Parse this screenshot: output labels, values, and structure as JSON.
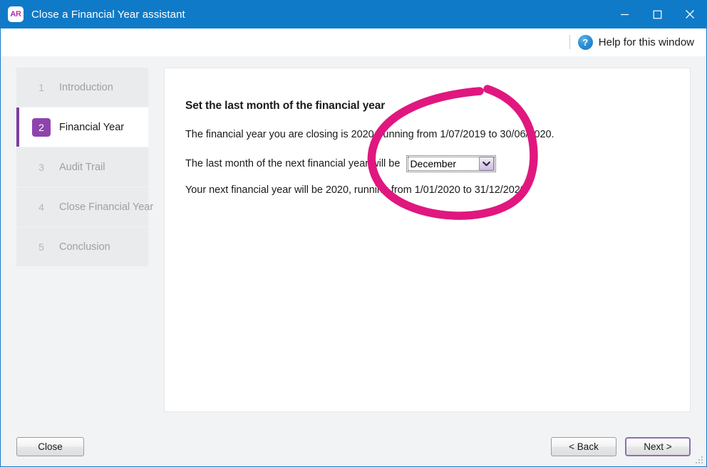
{
  "window": {
    "title": "Close a Financial Year assistant",
    "logo_text": "AR",
    "logo_icon": "ar-app-logo",
    "controls": {
      "minimize": "minimize-icon",
      "maximize": "maximize-icon",
      "close": "close-icon"
    }
  },
  "helpbar": {
    "icon": "question-mark-icon",
    "icon_glyph": "?",
    "label": "Help for this window"
  },
  "sidebar": {
    "steps": [
      {
        "number": "1",
        "label": "Introduction",
        "active": false
      },
      {
        "number": "2",
        "label": "Financial Year",
        "active": true
      },
      {
        "number": "3",
        "label": "Audit Trail",
        "active": false
      },
      {
        "number": "4",
        "label": "Close Financial Year",
        "active": false
      },
      {
        "number": "5",
        "label": "Conclusion",
        "active": false
      }
    ]
  },
  "content": {
    "heading": "Set the last month of the financial year",
    "line1": "The financial year you are closing is 2020, running from 1/07/2019 to 30/06/2020.",
    "line2_prefix": "The last month of the next financial year will be",
    "line3": "Your next financial year will be 2020, running from 1/01/2020 to 31/12/2020.",
    "month_select": {
      "value": "December",
      "arrow_icon": "chevron-down-icon"
    }
  },
  "footer": {
    "close_label": "Close",
    "back_label": "< Back",
    "next_label": "Next >",
    "resize_grip": "resize-grip-icon"
  },
  "annotation": {
    "shape": "hand-drawn-ellipse-highlight",
    "color": "#e0177f"
  },
  "colors": {
    "titlebar": "#0f7ac7",
    "accent_purple": "#7b3f9d",
    "badge_purple": "#8e44ad",
    "annotation_pink": "#e0177f",
    "body_gray": "#f1f3f5"
  }
}
